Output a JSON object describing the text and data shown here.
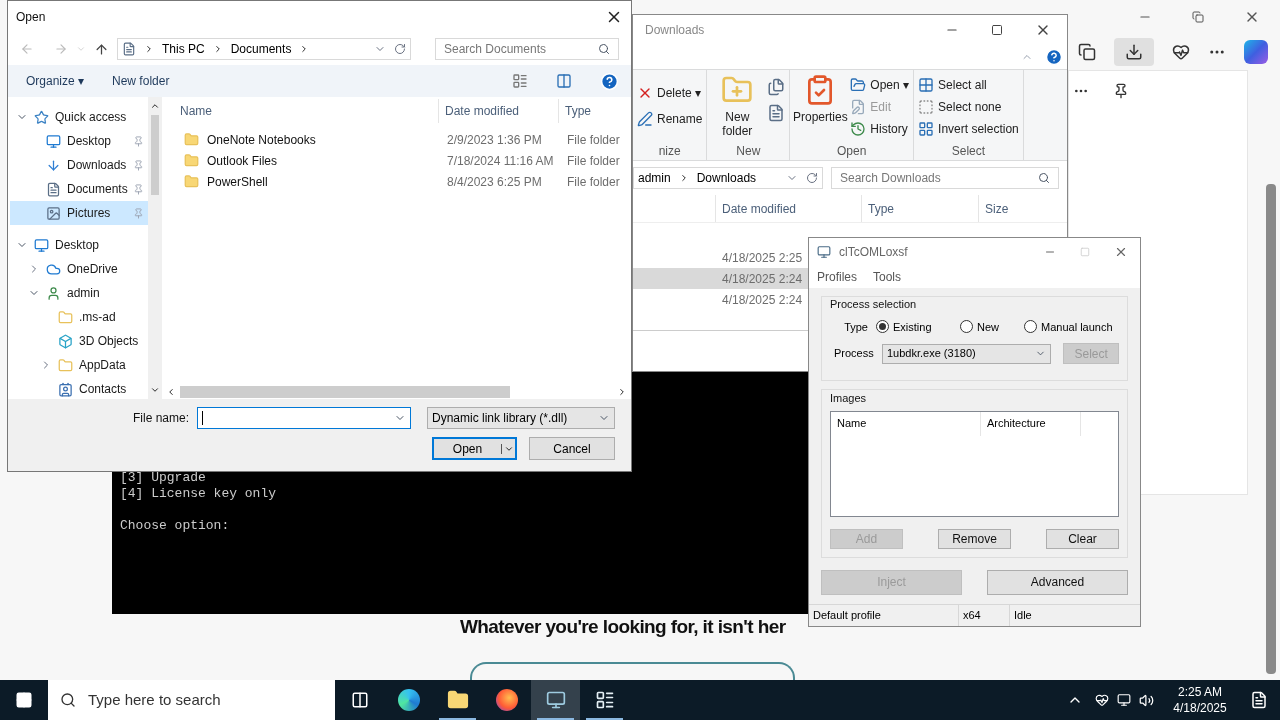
{
  "browser": {
    "page_heading": "Whatever you're looking for, it isn't her"
  },
  "console": {
    "blocks": [
      [
        "[3] Upgrade",
        "[4] License key only"
      ],
      [
        "Choose option:"
      ]
    ]
  },
  "explorer": {
    "title": "Downloads",
    "ribbon_groups": [
      {
        "label": "nize",
        "items": [
          {
            "label": "Delete ▾",
            "kind": "delete",
            "disabled": false
          },
          {
            "label": "Rename",
            "kind": "rename",
            "disabled": false
          }
        ]
      },
      {
        "label": "New",
        "items": [
          {
            "label": "New folder",
            "kind": "newfolder",
            "disabled": false
          }
        ]
      },
      {
        "label": "Open",
        "items": [
          {
            "label": "Properties",
            "kind": "properties",
            "disabled": false
          },
          {
            "label": "Open ▾",
            "kind": "open",
            "disabled": false
          },
          {
            "label": "Edit",
            "kind": "edit",
            "disabled": true
          },
          {
            "label": "History",
            "kind": "history",
            "disabled": false
          }
        ]
      },
      {
        "label": "Select",
        "items": [
          {
            "label": "Select all",
            "kind": "selectall",
            "disabled": false
          },
          {
            "label": "Select none",
            "kind": "selectnone",
            "disabled": false
          },
          {
            "label": "Invert selection",
            "kind": "invert",
            "disabled": false
          }
        ]
      }
    ],
    "breadcrumb": [
      "admin",
      "Downloads"
    ],
    "search": {
      "placeholder": "Search Downloads"
    },
    "columns": [
      "Date modified",
      "Type",
      "Size"
    ],
    "rows": [
      {
        "date": "4/18/2025 2:25",
        "selected": false
      },
      {
        "date": "4/18/2025 2:24",
        "selected": true
      },
      {
        "date": "4/18/2025 2:24",
        "selected": false
      }
    ]
  },
  "injector": {
    "title": "clTcOMLoxsf",
    "menu": [
      "Profiles",
      "Tools"
    ],
    "process_group": "Process selection",
    "type_label": "Type",
    "types": [
      {
        "label": "Existing",
        "selected": true
      },
      {
        "label": "New",
        "selected": false
      },
      {
        "label": "Manual launch",
        "selected": false
      }
    ],
    "process_label": "Process",
    "process_value": "1ubdkr.exe (3180)",
    "select_button": {
      "label": "Select",
      "disabled": true
    },
    "images_group": "Images",
    "columns": [
      "Name",
      "Architecture"
    ],
    "list_buttons": [
      {
        "label": "Add",
        "disabled": true
      },
      {
        "label": "Remove",
        "disabled": false
      },
      {
        "label": "Clear",
        "disabled": false
      }
    ],
    "main_buttons": [
      {
        "label": "Inject",
        "disabled": true
      },
      {
        "label": "Advanced",
        "disabled": false
      }
    ],
    "status_bar": [
      "Default profile",
      "x64",
      "Idle"
    ]
  },
  "open_dialog": {
    "title": "Open",
    "breadcrumb": [
      "This PC",
      "Documents"
    ],
    "search": {
      "placeholder": "Search Documents"
    },
    "toolbar": [
      "Organize ▾",
      "New folder"
    ],
    "tree": [
      {
        "label": "Quick access",
        "kind": "star",
        "expanded": true,
        "selected": false,
        "children": [
          {
            "label": "Desktop",
            "kind": "monitor",
            "pinned": true,
            "selected": false
          },
          {
            "label": "Downloads",
            "kind": "download",
            "pinned": true,
            "selected": false
          },
          {
            "label": "Documents",
            "kind": "document",
            "pinned": true,
            "selected": false
          },
          {
            "label": "Pictures",
            "kind": "picture",
            "pinned": true,
            "selected": true
          }
        ]
      },
      {
        "label": "Desktop",
        "kind": "monitor",
        "expanded": true,
        "selected": false,
        "children": [
          {
            "label": "OneDrive",
            "kind": "cloud",
            "expanded": false,
            "selected": false
          },
          {
            "label": "admin",
            "kind": "user",
            "expanded": true,
            "selected": false,
            "children": [
              {
                "label": ".ms-ad",
                "kind": "folder",
                "selected": false
              },
              {
                "label": "3D Objects",
                "kind": "cube",
                "selected": false
              },
              {
                "label": "AppData",
                "kind": "folder",
                "expanded": false,
                "selected": false
              },
              {
                "label": "Contacts",
                "kind": "contacts",
                "selected": false
              }
            ]
          }
        ]
      }
    ],
    "columns": [
      "Name",
      "Date modified",
      "Type"
    ],
    "files": [
      {
        "name": "OneNote Notebooks",
        "date": "2/9/2023 1:36 PM",
        "type": "File folder"
      },
      {
        "name": "Outlook Files",
        "date": "7/18/2024 11:16 AM",
        "type": "File folder"
      },
      {
        "name": "PowerShell",
        "date": "8/4/2023 6:25 PM",
        "type": "File folder"
      }
    ],
    "file_name_label": "File name:",
    "file_type": "Dynamic link library (*.dll)",
    "buttons": [
      "Open",
      "Cancel"
    ]
  },
  "taskbar": {
    "search_placeholder": "Type here to search",
    "apps": [
      {
        "kind": "taskview",
        "running": false,
        "active": false
      },
      {
        "kind": "edge",
        "running": false,
        "active": false
      },
      {
        "kind": "explorer",
        "running": true,
        "active": false
      },
      {
        "kind": "firefox",
        "running": false,
        "active": false
      },
      {
        "kind": "injector",
        "running": true,
        "active": true
      },
      {
        "kind": "console",
        "running": true,
        "active": false
      }
    ],
    "time": "2:25 AM",
    "date": "4/18/2025"
  }
}
